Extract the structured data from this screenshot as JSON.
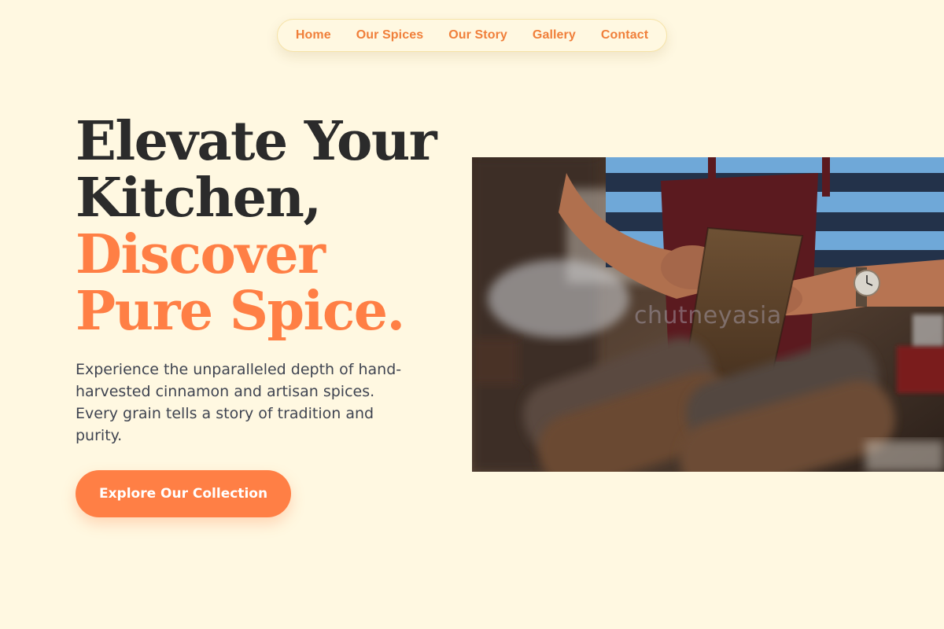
{
  "nav": {
    "items": [
      {
        "label": "Home"
      },
      {
        "label": "Our Spices"
      },
      {
        "label": "Our Story"
      },
      {
        "label": "Gallery"
      },
      {
        "label": "Contact"
      }
    ]
  },
  "hero": {
    "headline_line1": "Elevate Your",
    "headline_line2": "Kitchen,",
    "headline_line3": "Discover",
    "headline_line4": "Pure Spice.",
    "description": "Experience the unparalleled depth of hand-harvested cinnamon and artisan spices. Every grain tells a story of tradition and purity.",
    "cta_label": "Explore Our Collection"
  },
  "photo": {
    "watermark": "chutneyasia"
  },
  "colors": {
    "background": "#fff8e1",
    "accent": "#ff7f45",
    "nav_text": "#f07f3a",
    "heading_dark": "#2b2b2b",
    "body_text": "#3f4451"
  }
}
